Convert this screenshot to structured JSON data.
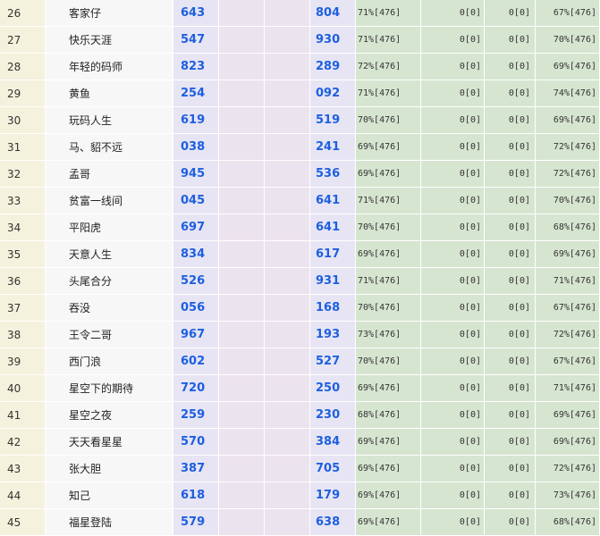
{
  "rows": [
    {
      "rank": "26",
      "name": "客家仔",
      "n1": "643",
      "n2": "804",
      "p1": "71%[476]",
      "p2": "0[0]",
      "p3": "0[0]",
      "p4": "67%[476]"
    },
    {
      "rank": "27",
      "name": "快乐天涯",
      "n1": "547",
      "n2": "930",
      "p1": "71%[476]",
      "p2": "0[0]",
      "p3": "0[0]",
      "p4": "70%[476]"
    },
    {
      "rank": "28",
      "name": "年轻的码师",
      "n1": "823",
      "n2": "289",
      "p1": "72%[476]",
      "p2": "0[0]",
      "p3": "0[0]",
      "p4": "69%[476]"
    },
    {
      "rank": "29",
      "name": "黄鱼",
      "n1": "254",
      "n2": "092",
      "p1": "71%[476]",
      "p2": "0[0]",
      "p3": "0[0]",
      "p4": "74%[476]"
    },
    {
      "rank": "30",
      "name": "玩码人生",
      "n1": "619",
      "n2": "519",
      "p1": "70%[476]",
      "p2": "0[0]",
      "p3": "0[0]",
      "p4": "69%[476]"
    },
    {
      "rank": "31",
      "name": "马、貂不远",
      "n1": "038",
      "n2": "241",
      "p1": "69%[476]",
      "p2": "0[0]",
      "p3": "0[0]",
      "p4": "72%[476]"
    },
    {
      "rank": "32",
      "name": "孟哥",
      "n1": "945",
      "n2": "536",
      "p1": "69%[476]",
      "p2": "0[0]",
      "p3": "0[0]",
      "p4": "72%[476]"
    },
    {
      "rank": "33",
      "name": "贫富一线间",
      "n1": "045",
      "n2": "641",
      "p1": "71%[476]",
      "p2": "0[0]",
      "p3": "0[0]",
      "p4": "70%[476]"
    },
    {
      "rank": "34",
      "name": "平阳虎",
      "n1": "697",
      "n2": "641",
      "p1": "70%[476]",
      "p2": "0[0]",
      "p3": "0[0]",
      "p4": "68%[476]"
    },
    {
      "rank": "35",
      "name": "天意人生",
      "n1": "834",
      "n2": "617",
      "p1": "69%[476]",
      "p2": "0[0]",
      "p3": "0[0]",
      "p4": "69%[476]"
    },
    {
      "rank": "36",
      "name": "头尾合分",
      "n1": "526",
      "n2": "931",
      "p1": "71%[476]",
      "p2": "0[0]",
      "p3": "0[0]",
      "p4": "71%[476]"
    },
    {
      "rank": "37",
      "name": "吞没",
      "n1": "056",
      "n2": "168",
      "p1": "70%[476]",
      "p2": "0[0]",
      "p3": "0[0]",
      "p4": "67%[476]"
    },
    {
      "rank": "38",
      "name": "王令二哥",
      "n1": "967",
      "n2": "193",
      "p1": "73%[476]",
      "p2": "0[0]",
      "p3": "0[0]",
      "p4": "72%[476]"
    },
    {
      "rank": "39",
      "name": "西门浪",
      "n1": "602",
      "n2": "527",
      "p1": "70%[476]",
      "p2": "0[0]",
      "p3": "0[0]",
      "p4": "67%[476]"
    },
    {
      "rank": "40",
      "name": "星空下的期待",
      "n1": "720",
      "n2": "250",
      "p1": "69%[476]",
      "p2": "0[0]",
      "p3": "0[0]",
      "p4": "71%[476]"
    },
    {
      "rank": "41",
      "name": "星空之夜",
      "n1": "259",
      "n2": "230",
      "p1": "68%[476]",
      "p2": "0[0]",
      "p3": "0[0]",
      "p4": "69%[476]"
    },
    {
      "rank": "42",
      "name": "天天看星星",
      "n1": "570",
      "n2": "384",
      "p1": "69%[476]",
      "p2": "0[0]",
      "p3": "0[0]",
      "p4": "69%[476]"
    },
    {
      "rank": "43",
      "name": "张大胆",
      "n1": "387",
      "n2": "705",
      "p1": "69%[476]",
      "p2": "0[0]",
      "p3": "0[0]",
      "p4": "72%[476]"
    },
    {
      "rank": "44",
      "name": "知己",
      "n1": "618",
      "n2": "179",
      "p1": "69%[476]",
      "p2": "0[0]",
      "p3": "0[0]",
      "p4": "73%[476]"
    },
    {
      "rank": "45",
      "name": "福星登陆",
      "n1": "579",
      "n2": "638",
      "p1": "69%[476]",
      "p2": "0[0]",
      "p3": "0[0]",
      "p4": "68%[476]"
    }
  ]
}
